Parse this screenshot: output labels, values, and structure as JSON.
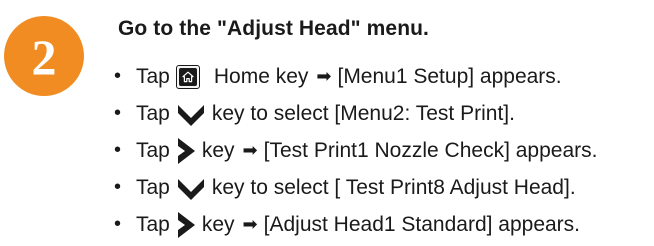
{
  "step": {
    "number": "2",
    "badge_color": "#f08c21",
    "heading": "Go to the \"Adjust Head\" menu."
  },
  "bullet_char": "•",
  "items": [
    {
      "tap": "Tap",
      "key_icon": "home-key-icon",
      "arrow": true,
      "text_before_arrow": "Home key",
      "text_after_arrow": "[Menu1 Setup] appears."
    },
    {
      "tap": "Tap",
      "key_icon": "down-chevron-key-icon",
      "arrow": false,
      "text": "key to select [Menu2: Test Print]."
    },
    {
      "tap": "Tap",
      "key_icon": "right-chevron-key-icon",
      "arrow": true,
      "text_before_arrow": "key",
      "text_after_arrow": "[Test Print1 Nozzle Check] appears."
    },
    {
      "tap": "Tap",
      "key_icon": "down-chevron-key-icon",
      "arrow": false,
      "text": "key to select [ Test Print8 Adjust Head]."
    },
    {
      "tap": "Tap",
      "key_icon": "right-chevron-key-icon",
      "arrow": true,
      "text_before_arrow": "key",
      "text_after_arrow": "[Adjust Head1 Standard] appears."
    }
  ]
}
